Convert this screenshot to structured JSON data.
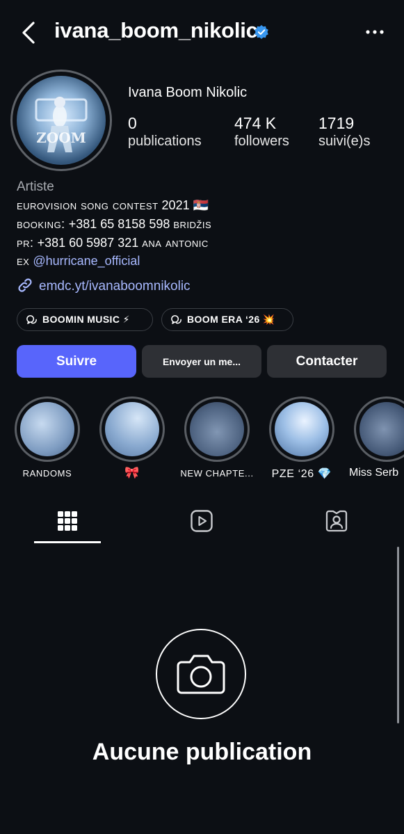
{
  "header": {
    "username": "ivana_boom_nikolic",
    "verified_icon": "verified-badge-icon",
    "back_icon": "chevron-left-icon",
    "more_icon": "more-horizontal-icon"
  },
  "profile": {
    "display_name": "Ivana Boom Nikolic",
    "stats": [
      {
        "value": "0",
        "label": "publications"
      },
      {
        "value": "474 K",
        "label": "followers"
      },
      {
        "value": "1719",
        "label": "suivi(e)s"
      }
    ]
  },
  "bio": {
    "category": "Artiste",
    "lines": {
      "line1_main": "eurovision song contest",
      "line1_year": "2021",
      "line1_flag": "🇷🇸",
      "line2_label": "booking:",
      "line2_phone": "+381 65 8158 598",
      "line2_name": "bridžis",
      "line3_label": "pr:",
      "line3_phone": "+381 60 5987 321",
      "line3_name": "ana antonic",
      "line4_prefix": "ex",
      "line4_mention": "@hurricane_official"
    },
    "link": "emdc.yt/ivanaboomnikolic"
  },
  "channels": [
    {
      "label": "BOOMIN MUSIC ⚡"
    },
    {
      "label": "BOOM ERA ‘26 💥"
    }
  ],
  "actions": {
    "follow": "Suivre",
    "message": "Envoyer un me...",
    "contact": "Contacter"
  },
  "highlights": [
    {
      "label": "RANDOMS"
    },
    {
      "label": "🎀"
    },
    {
      "label": "NEW CHAPTE..."
    },
    {
      "label": "PZE ‘26 💎"
    },
    {
      "label": "Miss Serb"
    }
  ],
  "tabs": [
    {
      "name": "grid-icon",
      "active": true
    },
    {
      "name": "reels-icon",
      "active": false
    },
    {
      "name": "tagged-icon",
      "active": false
    }
  ],
  "empty_state": {
    "icon": "camera-icon",
    "title": "Aucune publication"
  },
  "colors": {
    "background": "#0c0f14",
    "follow_button": "#5865fb",
    "secondary_button": "#2e3035",
    "link": "#a8b9ff",
    "verified": "#3897f0"
  }
}
